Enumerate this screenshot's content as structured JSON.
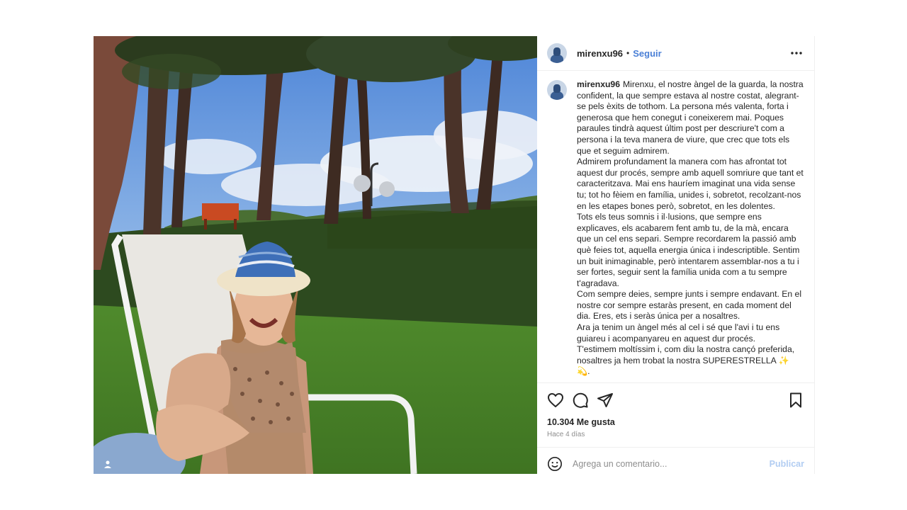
{
  "post": {
    "username": "mirenxu96",
    "dot": "•",
    "follow_label": "Seguir",
    "more_icon": "more-options-icon",
    "caption": "Mirenxu, el nostre àngel de la guarda, la nostra confident, la que sempre estava al nostre costat, alegrant-se pels èxits de tothom. La persona més valenta, forta i generosa que hem conegut i coneixerem mai. Poques paraules tindrà aquest últim post per descriure't com a persona i la teva manera de viure, que crec que tots els que et seguim admirem.\nAdmirem profundament la manera com has afrontat tot aquest dur procés, sempre amb aquell somriure que tant et caracteritzava. Mai ens hauríem imaginat una vida sense tu; tot ho fèiem en família, unides i, sobretot, recolzant-nos en les etapes bones però, sobretot, en les dolentes.\nTots els teus somnis i il·lusions, que sempre ens explicaves, els acabarem fent amb tu, de la mà, encara que un cel ens separi. Sempre recordarem la passió amb què feies tot, aquella energia única i indescriptible. Sentim un buit inimaginable, però intentarem assemblar-nos a tu i ser fortes, seguir sent la família unida com a tu sempre t'agradava.\nCom sempre deies, sempre junts i sempre endavant. En el nostre cor sempre estaràs present, en cada moment del dia. Eres, ets i seràs única per a nosaltres.\nAra ja tenim un àngel més al cel i sé que l'avi i tu ens guiareu i acompanyareu en aquest dur procés.\nT'estimem moltíssim i, com diu la nostra cançó preferida, nosaltres ja hem trobat la nostra SUPERESTRELLA ✨ 💫.",
    "likes": "10.304 Me gusta",
    "time_ago": "Hace 4 días",
    "comment_placeholder": "Agrega un comentario...",
    "publish_label": "Publicar"
  },
  "icons": {
    "like": "heart-icon",
    "comment": "comment-icon",
    "share": "share-icon",
    "save": "bookmark-icon",
    "emoji": "emoji-icon",
    "user_tag": "user-tag-icon"
  }
}
